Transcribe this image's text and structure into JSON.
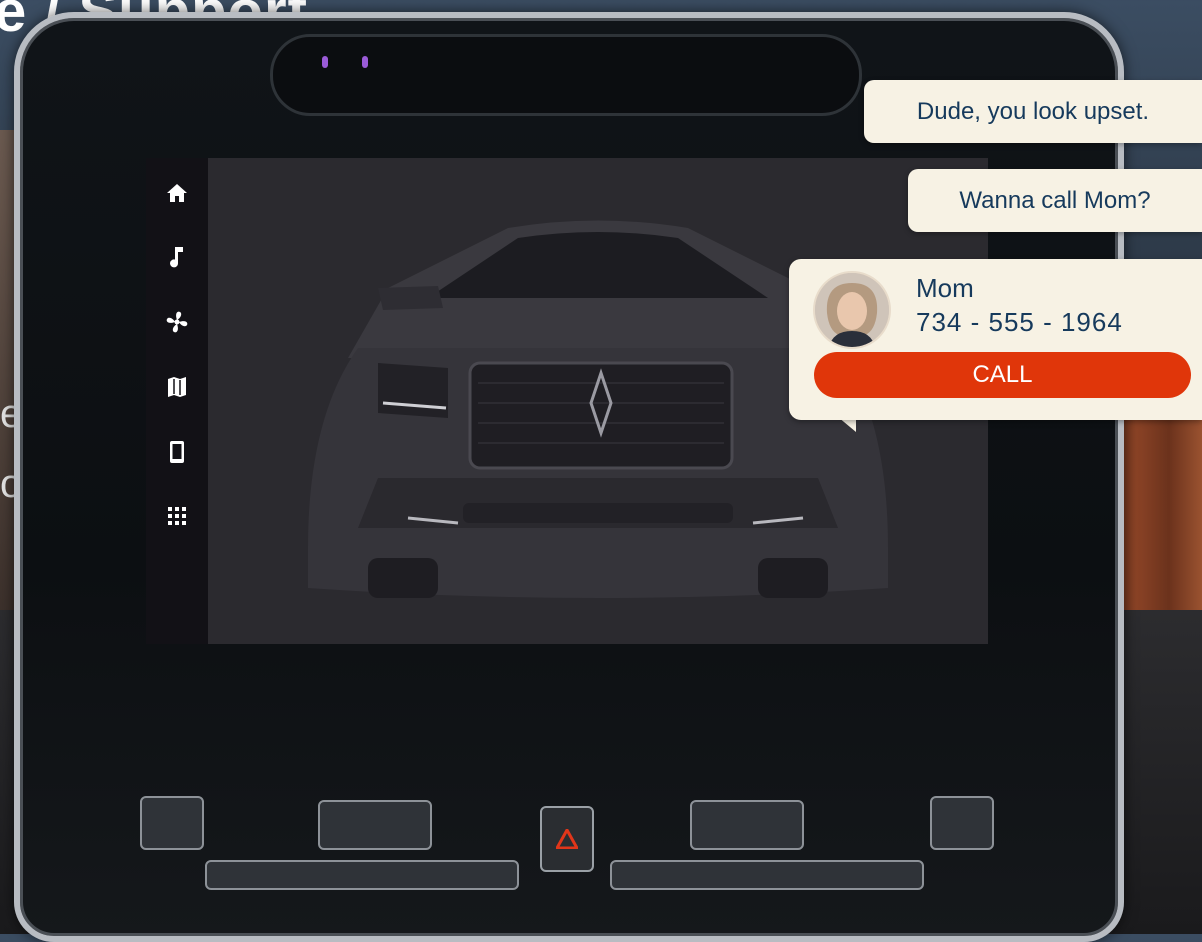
{
  "background": {
    "title": "e / Support",
    "line1": "eone",
    "line2": "omeone"
  },
  "side_nav": {
    "items": [
      {
        "icon": "home-icon"
      },
      {
        "icon": "music-note-icon"
      },
      {
        "icon": "fan-icon"
      },
      {
        "icon": "map-icon"
      },
      {
        "icon": "phone-icon"
      },
      {
        "icon": "apps-grid-icon"
      }
    ]
  },
  "messages": {
    "first": "Dude, you look upset.",
    "second": "Wanna call Mom?"
  },
  "contact": {
    "name": "Mom",
    "number": "734 - 555 - 1964",
    "call_label": "CALL"
  },
  "colors": {
    "bubble_bg": "#f7f2e4",
    "text": "#163a5c",
    "call_button": "#e0360a",
    "nav_bg": "#121116",
    "screen_bg": "#2b2a2f"
  }
}
